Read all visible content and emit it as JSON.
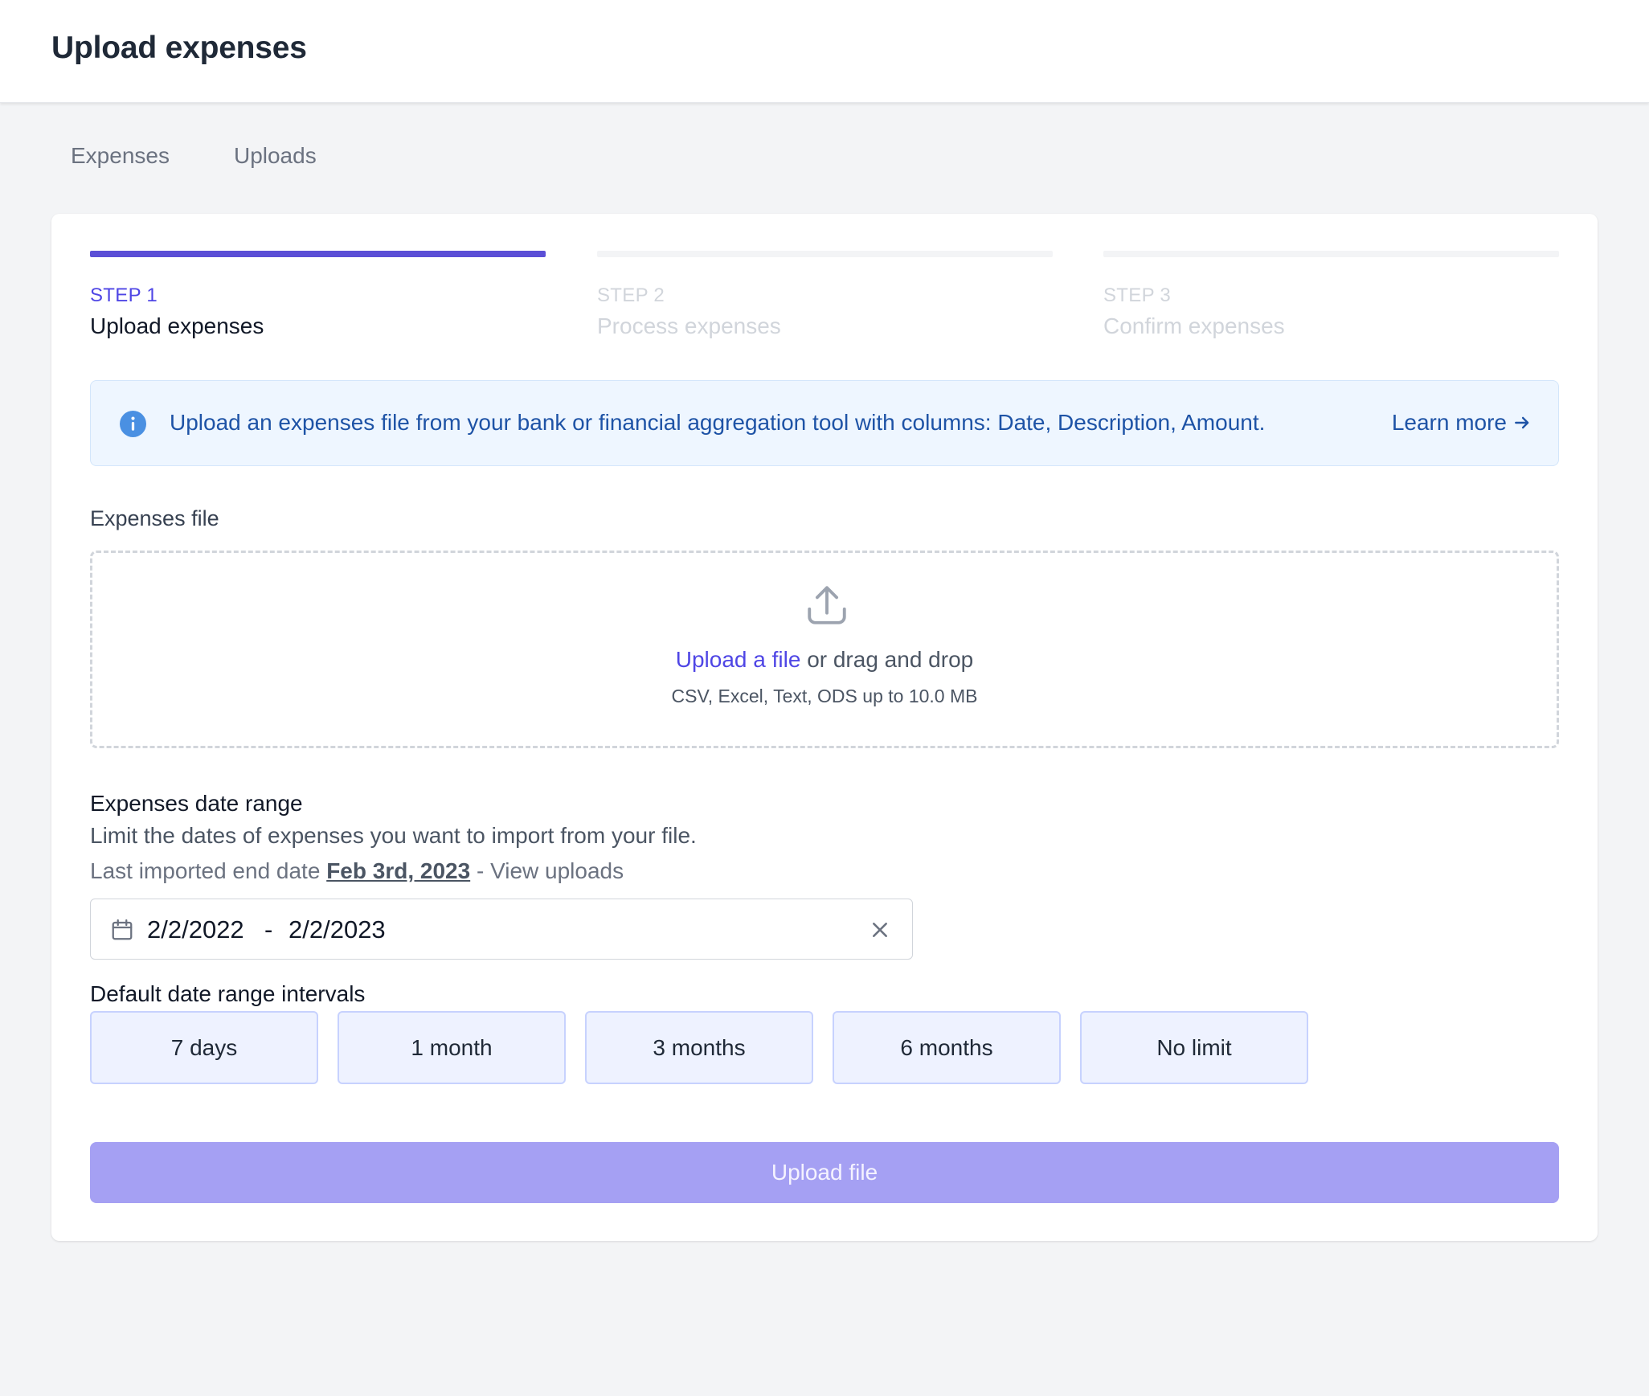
{
  "header": {
    "title": "Upload expenses"
  },
  "tabs": [
    {
      "label": "Expenses"
    },
    {
      "label": "Uploads"
    }
  ],
  "steps": [
    {
      "num": "STEP 1",
      "name": "Upload expenses",
      "state": "active"
    },
    {
      "num": "STEP 2",
      "name": "Process expenses",
      "state": "upcoming"
    },
    {
      "num": "STEP 3",
      "name": "Confirm expenses",
      "state": "upcoming"
    }
  ],
  "alert": {
    "icon": "info-icon",
    "message": "Upload an expenses file from your bank or financial aggregation tool with columns: Date, Description, Amount.",
    "link_label": "Learn more",
    "link_icon": "arrow-right-icon"
  },
  "file": {
    "label": "Expenses file",
    "upload_icon": "upload-icon",
    "upload_link": "Upload a file",
    "drag_text": "or drag and drop",
    "hint": "CSV, Excel, Text, ODS up to 10.0 MB"
  },
  "daterange": {
    "title": "Expenses date range",
    "description": "Limit the dates of expenses you want to import from your file.",
    "last_imported_prefix": "Last imported end date",
    "last_imported_date": "Feb 3rd, 2023",
    "view_uploads": "- View uploads",
    "start": "2/2/2022",
    "separator": "-",
    "end": "2/2/2023",
    "calendar_icon": "calendar-icon",
    "clear_icon": "close-icon"
  },
  "intervals": {
    "title": "Default date range intervals",
    "options": [
      "7 days",
      "1 month",
      "3 months",
      "6 months",
      "No limit"
    ]
  },
  "submit": {
    "label": "Upload file"
  },
  "colors": {
    "accent": "#4f46e5",
    "step_active_bar": "#5b4fd6",
    "alert_bg": "#eef6ff",
    "alert_text": "#1e53a6",
    "submit_bg": "#a5a0f3"
  }
}
